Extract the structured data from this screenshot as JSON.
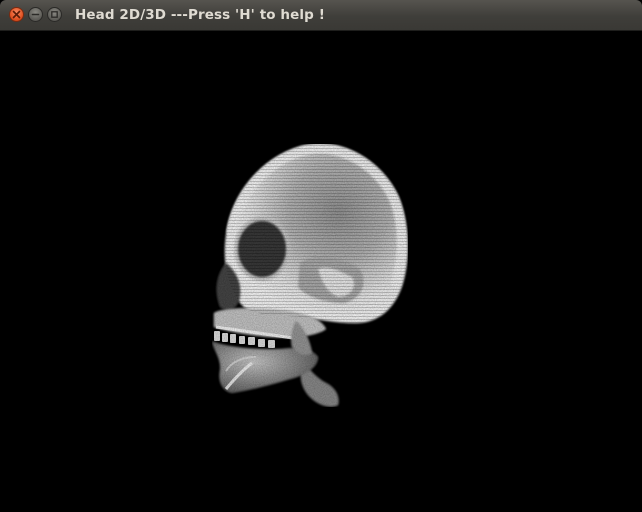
{
  "window": {
    "title": "Head 2D/3D ---Press 'H' to help !",
    "controls": {
      "close_icon": "close-icon",
      "minimize_icon": "minimize-icon",
      "maximize_icon": "maximize-icon"
    }
  },
  "viewport": {
    "background": "#000000",
    "render_subject": "skull-volume-render",
    "render_color": "#ffffff"
  }
}
